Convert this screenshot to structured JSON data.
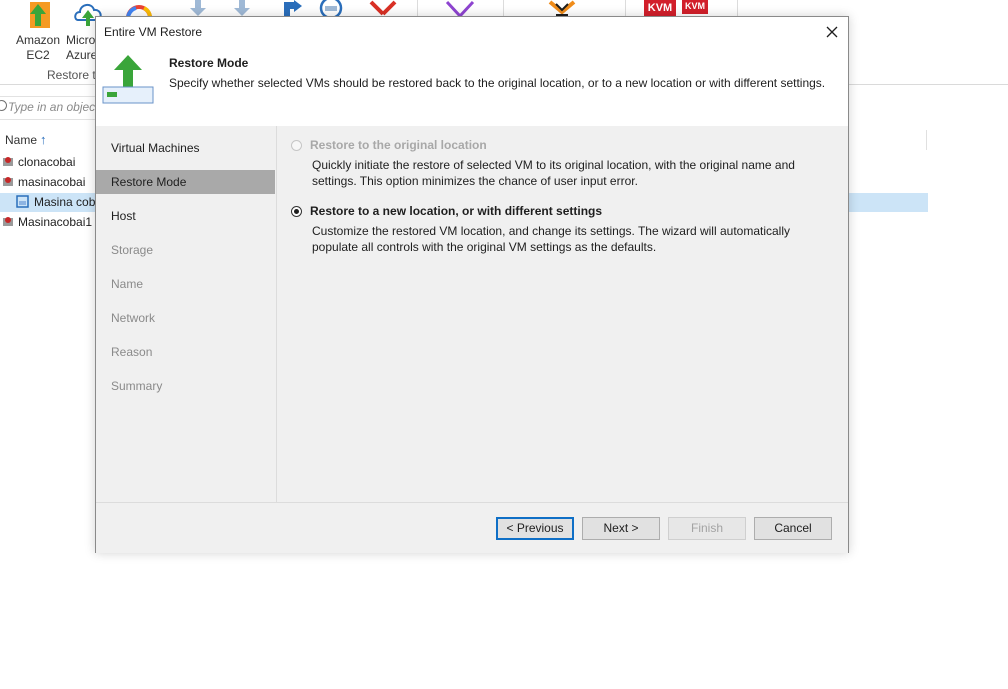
{
  "ribbon": {
    "amazon_label": "Amazon",
    "amazon_sub": "EC2",
    "azure_label": "Micro",
    "azure_sub": "Azure",
    "group_label": "Restore t",
    "kvm_label": "KVM"
  },
  "tree": {
    "search_placeholder": "Type in an object",
    "column_name": "Name",
    "items": [
      {
        "label": "clonacobai"
      },
      {
        "label": "masinacobai"
      },
      {
        "label": "Masina cob"
      },
      {
        "label": "Masinacobai1"
      }
    ]
  },
  "dialog": {
    "title": "Entire VM Restore",
    "header_title": "Restore Mode",
    "header_desc": "Specify whether selected VMs should be restored back to the original location, or to a new location or with different settings.",
    "steps": [
      {
        "label": "Virtual Machines"
      },
      {
        "label": "Restore Mode"
      },
      {
        "label": "Host"
      },
      {
        "label": "Storage"
      },
      {
        "label": "Name"
      },
      {
        "label": "Network"
      },
      {
        "label": "Reason"
      },
      {
        "label": "Summary"
      }
    ],
    "options": [
      {
        "label": "Restore to the original location",
        "desc": "Quickly initiate the restore of selected VM to its original location, with the original name and settings. This option minimizes the chance of user input error."
      },
      {
        "label": "Restore to a new location, or with different settings",
        "desc": "Customize the restored VM location, and change its settings. The wizard will automatically populate all controls with the original VM settings as the defaults."
      }
    ],
    "buttons": {
      "previous": "< Previous",
      "next": "Next >",
      "finish": "Finish",
      "cancel": "Cancel"
    }
  },
  "colors": {
    "accent": "#0f6fc6",
    "selection": "#cce4f7",
    "arrow_green": "#3aa53a",
    "active_step": "#a9a9a9"
  },
  "icons": [
    "aws-icon",
    "azure-cloud-icon",
    "google-cloud-icon",
    "download-arrow-icon",
    "redirect-arrow-icon",
    "search-disk-icon",
    "delete-x-icon",
    "purple-x-icon",
    "orange-x-icon",
    "kvm-icon",
    "vm-icon",
    "close-icon",
    "restore-arrow-icon"
  ]
}
